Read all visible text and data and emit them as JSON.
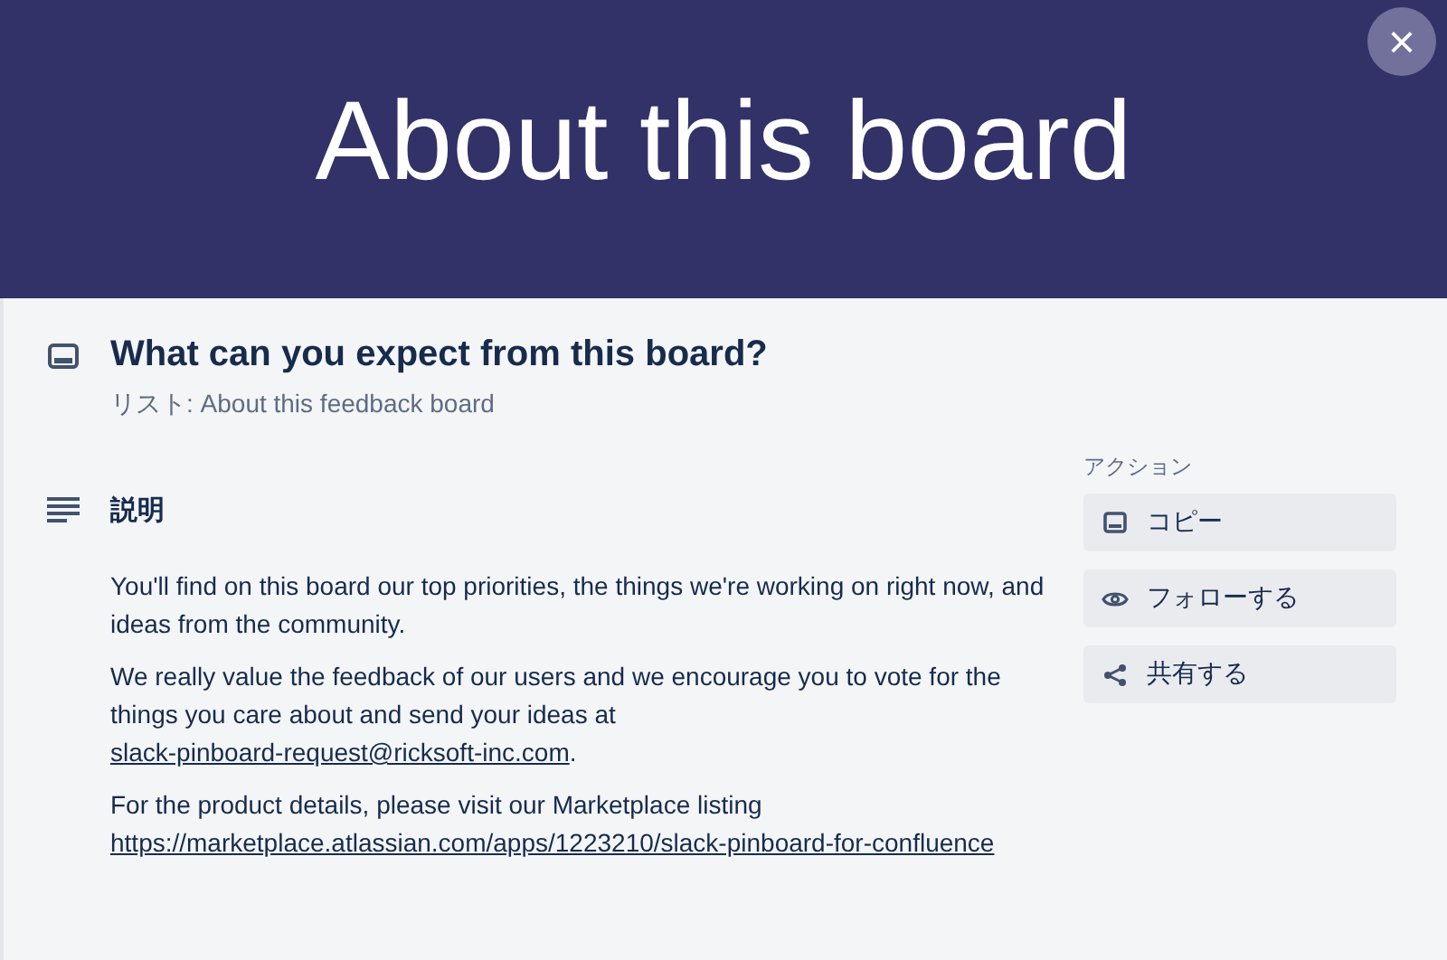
{
  "cover": {
    "title": "About this board",
    "close_label": "×"
  },
  "card": {
    "title": "What can you expect from this board?",
    "list_label": "リスト: About this feedback board"
  },
  "description": {
    "heading": "説明",
    "paragraphs": [
      [
        {
          "kind": "text",
          "text": "You'll find on this board our top priorities, the things we're working on right now, and ideas from the community."
        }
      ],
      [
        {
          "kind": "text",
          "text": "We really value the feedback of our users and we encourage you to vote for the things you care about and send your ideas at "
        },
        {
          "kind": "link",
          "text": "slack-pinboard-request@ricksoft-inc.com"
        },
        {
          "kind": "text",
          "text": "."
        }
      ],
      [
        {
          "kind": "text",
          "text": "For the product details, please visit our Marketplace listing "
        },
        {
          "kind": "link",
          "text": "https://marketplace.atlassian.com/apps/1223210/slack-pinboard-for-confluence"
        }
      ]
    ]
  },
  "actions": {
    "heading": "アクション",
    "buttons": [
      {
        "kind": "copy",
        "label": "コピー"
      },
      {
        "kind": "follow",
        "label": "フォローする"
      },
      {
        "kind": "share",
        "label": "共有する"
      }
    ]
  }
}
